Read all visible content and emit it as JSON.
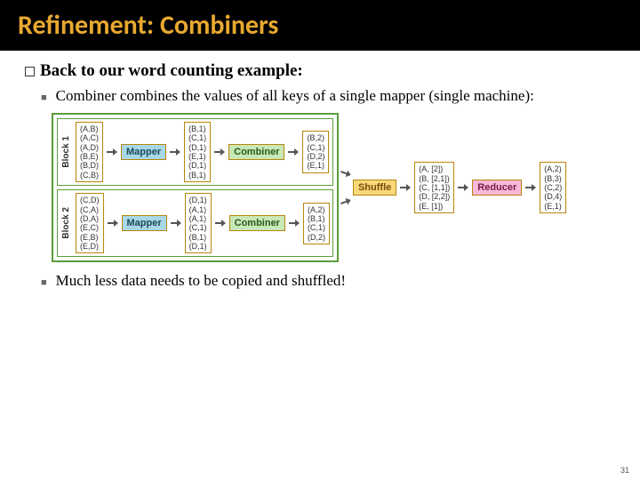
{
  "title": "Refinement: Combiners",
  "heading": "Back to our word counting example:",
  "bullet1": "Combiner combines the values of all keys of a single mapper (single machine):",
  "bullet2": "Much less data needs to be copied and shuffled!",
  "page_num": "31",
  "diagram": {
    "block1_label": "Block 1",
    "block2_label": "Block 2",
    "mapper_label": "Mapper",
    "combiner_label": "Combiner",
    "shuffle_label": "Shuffle",
    "reducer_label": "Reducer",
    "block1_input": "(A,B)\n(A,C)\n(A,D)\n(B,E)\n(B,D)\n(C,B)",
    "block1_mapout": "(B,1)\n(C,1)\n(D,1)\n(E,1)\n(D,1)\n(B,1)",
    "block1_combout": "(B,2)\n(C,1)\n(D,2)\n(E,1)",
    "block2_input": "(C,D)\n(C,A)\n(D,A)\n(E,C)\n(E,B)\n(E,D)",
    "block2_mapout": "(D,1)\n(A,1)\n(A,1)\n(C,1)\n(B,1)\n(D,1)",
    "block2_combout": "(A,2)\n(B,1)\n(C,1)\n(D,2)",
    "shuffle_out": "(A, [2])\n(B, [2,1])\n(C, [1,1])\n(D, [2,2])\n(E, [1])",
    "reducer_out": "(A,2)\n(B,3)\n(C,2)\n(D,4)\n(E,1)"
  }
}
